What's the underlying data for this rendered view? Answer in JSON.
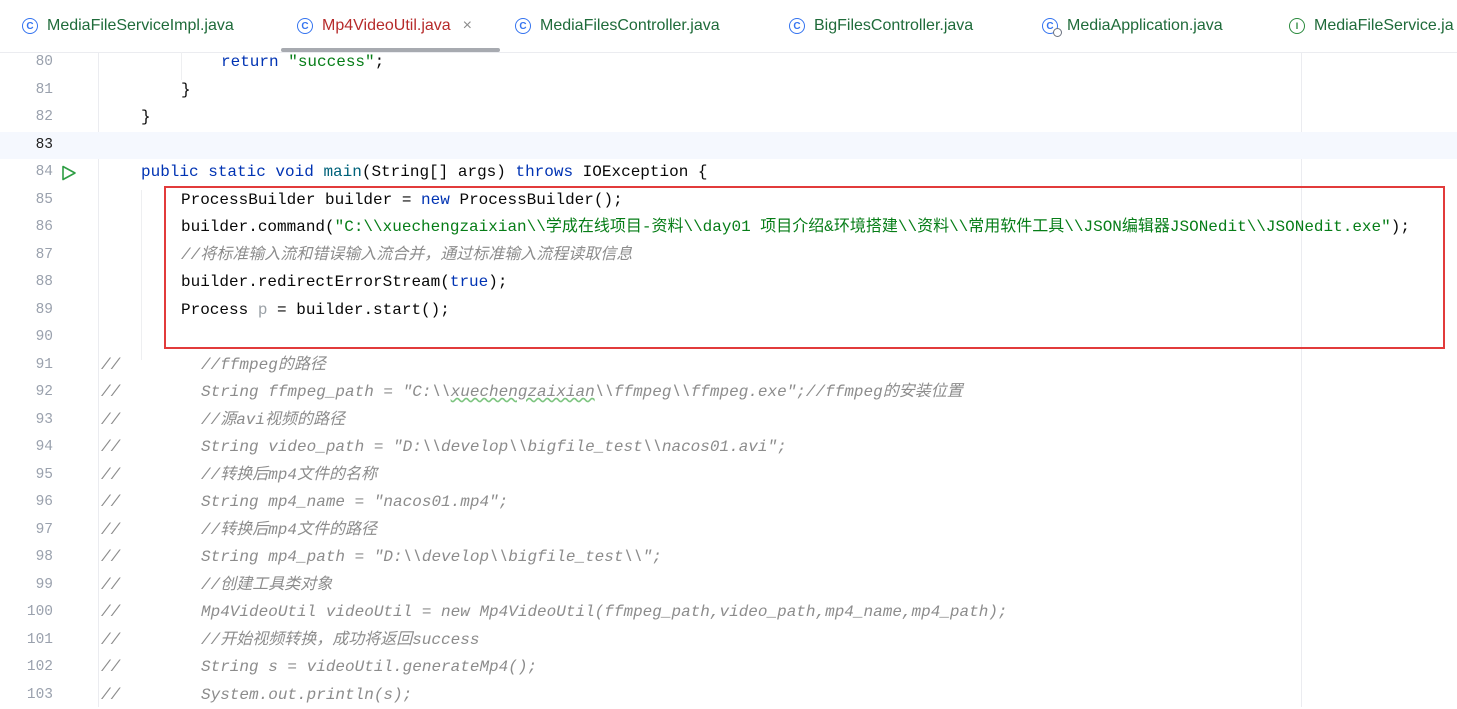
{
  "tabs": [
    {
      "label": "MediaFileServiceImpl.java",
      "icon": "class-icon",
      "active": false
    },
    {
      "label": "Mp4VideoUtil.java",
      "icon": "class-icon",
      "active": true,
      "close": "×"
    },
    {
      "label": "MediaFilesController.java",
      "icon": "class-icon",
      "active": false
    },
    {
      "label": "BigFilesController.java",
      "icon": "class-icon",
      "active": false
    },
    {
      "label": "MediaApplication.java",
      "icon": "spring-app-class-icon",
      "active": false
    },
    {
      "label": "MediaFileService.ja",
      "icon": "interface-icon",
      "active": false
    }
  ],
  "icon_glyphs": {
    "class": "C",
    "interface": "I"
  },
  "colors": {
    "keyword": "#0033b3",
    "string": "#067d17",
    "comment": "#8c8c8c",
    "method": "#00627a",
    "highlight_border": "#e23b3b"
  },
  "editor": {
    "current_line": "83",
    "run_gutter_line": "84",
    "lines": [
      {
        "n": "80",
        "tokens": [
          {
            "t": "return",
            "c": "kw"
          },
          {
            "t": " "
          },
          {
            "t": "\"success\"",
            "c": "str"
          },
          {
            "t": ";"
          }
        ]
      },
      {
        "n": "81",
        "tokens": [
          {
            "t": "}"
          }
        ]
      },
      {
        "n": "82",
        "tokens": [
          {
            "t": "}"
          }
        ]
      },
      {
        "n": "83",
        "tokens": []
      },
      {
        "n": "84",
        "tokens": [
          {
            "t": "public static void ",
            "c": "kw"
          },
          {
            "t": "main",
            "c": "fn"
          },
          {
            "t": "(String[] args) "
          },
          {
            "t": "throws",
            "c": "kw"
          },
          {
            "t": " IOException {"
          }
        ]
      },
      {
        "n": "85",
        "tokens": [
          {
            "t": "ProcessBuilder builder = "
          },
          {
            "t": "new",
            "c": "kw"
          },
          {
            "t": " ProcessBuilder();"
          }
        ]
      },
      {
        "n": "86",
        "tokens": [
          {
            "t": "builder.command("
          },
          {
            "t": "\"C:\\\\xuechengzaixian\\\\学成在线项目-资料\\\\day01 项目介绍&环境搭建\\\\资料\\\\常用软件工具\\\\JSON编辑器JSONedit\\\\JSONedit.exe\"",
            "c": "str"
          },
          {
            "t": ");"
          }
        ]
      },
      {
        "n": "87",
        "tokens": [
          {
            "t": "//将标准输入流和错误输入流合并，通过标准输入流程读取信息",
            "c": "cm"
          }
        ]
      },
      {
        "n": "88",
        "tokens": [
          {
            "t": "builder.redirectErrorStream("
          },
          {
            "t": "true",
            "c": "kw"
          },
          {
            "t": ");"
          }
        ]
      },
      {
        "n": "89",
        "tokens": [
          {
            "t": "Process "
          },
          {
            "t": "p",
            "c": "dim"
          },
          {
            "t": " = builder.start();"
          }
        ]
      },
      {
        "n": "90",
        "tokens": []
      },
      {
        "n": "91",
        "prefix": "//",
        "tokens": [
          {
            "t": "//ffmpeg的路径",
            "c": "cm"
          }
        ]
      },
      {
        "n": "92",
        "prefix": "//",
        "tokens": [
          {
            "t": "String ffmpeg_path = \"C:\\\\",
            "c": "cm"
          },
          {
            "t": "xuechengzaixian",
            "c": "cm-u"
          },
          {
            "t": "\\\\ffmpeg\\\\ffmpeg.exe\";//ffmpeg的安装位置",
            "c": "cm"
          }
        ]
      },
      {
        "n": "93",
        "prefix": "//",
        "tokens": [
          {
            "t": "//源avi视频的路径",
            "c": "cm"
          }
        ]
      },
      {
        "n": "94",
        "prefix": "//",
        "tokens": [
          {
            "t": "String video_path = \"D:\\\\develop\\\\bigfile_test\\\\nacos01.avi\";",
            "c": "cm"
          }
        ]
      },
      {
        "n": "95",
        "prefix": "//",
        "tokens": [
          {
            "t": "//转换后mp4文件的名称",
            "c": "cm"
          }
        ]
      },
      {
        "n": "96",
        "prefix": "//",
        "tokens": [
          {
            "t": "String mp4_name = \"nacos01.mp4\";",
            "c": "cm"
          }
        ]
      },
      {
        "n": "97",
        "prefix": "//",
        "tokens": [
          {
            "t": "//转换后mp4文件的路径",
            "c": "cm"
          }
        ]
      },
      {
        "n": "98",
        "prefix": "//",
        "tokens": [
          {
            "t": "String mp4_path = \"D:\\\\develop\\\\bigfile_test\\\\\";",
            "c": "cm"
          }
        ]
      },
      {
        "n": "99",
        "prefix": "//",
        "tokens": [
          {
            "t": "//创建工具类对象",
            "c": "cm"
          }
        ]
      },
      {
        "n": "100",
        "prefix": "//",
        "tokens": [
          {
            "t": "Mp4VideoUtil videoUtil = new Mp4VideoUtil(ffmpeg_path,video_path,mp4_name,mp4_path);",
            "c": "cm"
          }
        ]
      },
      {
        "n": "101",
        "prefix": "//",
        "tokens": [
          {
            "t": "//开始视频转换，成功将返回success",
            "c": "cm"
          }
        ]
      },
      {
        "n": "102",
        "prefix": "//",
        "tokens": [
          {
            "t": "String s = videoUtil.generateMp4();",
            "c": "cm"
          }
        ]
      },
      {
        "n": "103",
        "prefix": "//",
        "tokens": [
          {
            "t": "System.out.println(s);",
            "c": "cm"
          }
        ]
      }
    ]
  }
}
